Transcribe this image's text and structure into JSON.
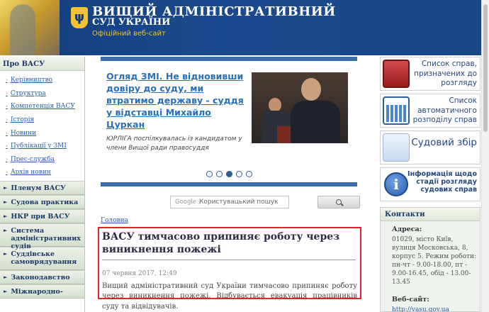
{
  "header": {
    "title_line1": "ВИЩИЙ АДМІНІСТРАТИВНИЙ",
    "title_line2": "СУД УКРАЇНИ",
    "subtitle": "Офіційний веб-сайт",
    "emblem": "ψ"
  },
  "left_menu": {
    "section_title": "Про ВАСУ",
    "subitems": [
      "Керівництво",
      "Структура",
      "Компетенція ВАСУ",
      "Історія",
      "Новини",
      "Публікації у ЗМІ",
      "Прес-служба",
      "Архів новин"
    ],
    "items": [
      "Пленум ВАСУ",
      "Судова практика",
      "НКР при ВАСУ",
      "Система адміністративних судів",
      "Суддівське самоврядування",
      "Законодавство",
      "Міжнародно-"
    ]
  },
  "slider": {
    "title": "Огляд ЗМІ. Не відновивши довіру до суду, ми втратимо державу - суддя у відставці Михайло Цуркан",
    "caption": "ЮРЛІГА поспілкувалась із кандидатом у члени Вищої ради правосуддя",
    "dots_count": 5,
    "active_dot": 3
  },
  "search": {
    "google_label": "Google",
    "placeholder": "Користувацький пошук"
  },
  "breadcrumb": "Головна",
  "article": {
    "title": "ВАСУ тимчасово припиняє роботу через виникнення пожежі",
    "date": "07 червня 2017, 12:49",
    "text": "Вищий адміністративний суд України тимчасово припиняє роботу через виникнення пожежі. Відбувається евакуація працівників суду та відвідувачів."
  },
  "right_panel": {
    "box1": "Список справ, призначених до розгляду",
    "box2": "Список автоматичного розподілу справ",
    "box3": "Судовий збір",
    "box4": "Інформація щодо стадії розгляду судових справ",
    "contacts_title": "Контакти",
    "address_label": "Адреса:",
    "address_text": "01029, місто Київ, вулиця Московська, 8, корпус 5. Режим роботи: пн-чт - 9.00-18.00, пт - 9.00-16.45, обід - 13.00-13.45",
    "website_label": "Веб-сайт:",
    "website_url": "http://vasu.gov.ua"
  },
  "colors": {
    "header_bg": "#1b4b8f",
    "accent_gold": "#f2c230",
    "link_blue": "#2a5fa8",
    "highlight_red": "#d9262c"
  }
}
